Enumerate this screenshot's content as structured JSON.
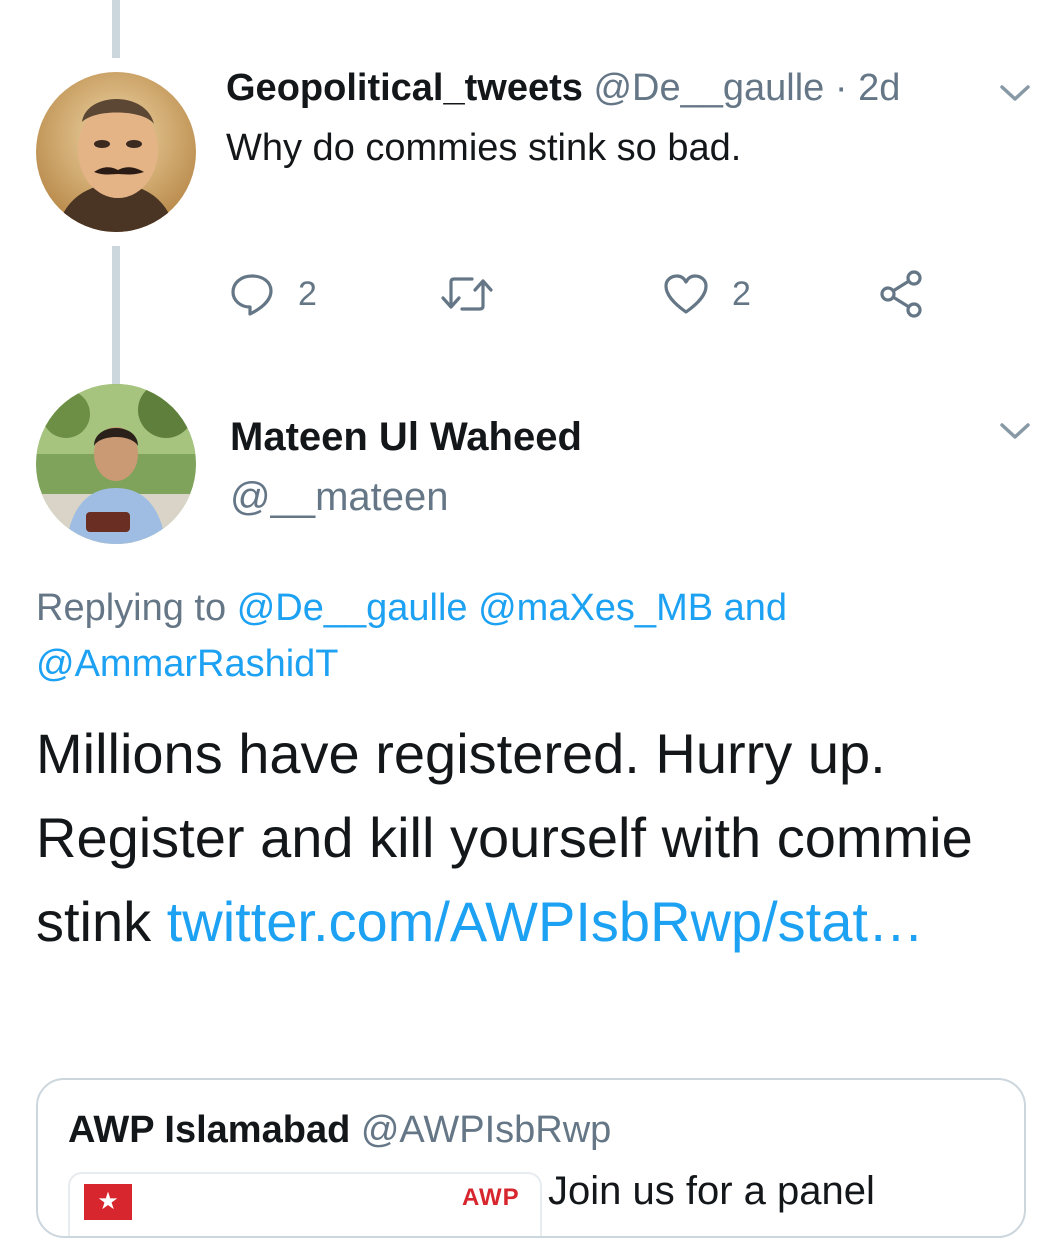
{
  "tweet1": {
    "display_name": "Geopolitical_tweets",
    "handle": "@De__gaulle",
    "separator": " · ",
    "time": "2d",
    "text": "Why do commies stink so bad.",
    "actions": {
      "reply_count": "2",
      "like_count": "2"
    }
  },
  "tweet2": {
    "display_name": "Mateen Ul Waheed",
    "handle": "@__mateen",
    "replying_prefix": "Replying to",
    "replying_mention1": "@De__gaulle",
    "replying_mention2": "@maXes_MB",
    "replying_and": "and",
    "replying_mention3": "@AmmarRashidT",
    "text": "Millions have registered. Hurry up. Register and kill yourself with commie stink",
    "link_text": "twitter.com/AWPIsbRwp/stat…"
  },
  "quoted_tweet": {
    "display_name": "AWP Islamabad",
    "handle": "@AWPIsbRwp",
    "media_flag": "★",
    "media_logo_text": "AWP",
    "text": "Join us for a panel"
  },
  "colors": {
    "link": "#1da1f2",
    "secondary_text": "#657786",
    "primary_text": "#14171a",
    "thread_line": "#ccd6dd"
  },
  "icons": {
    "caret": "chevron-down-icon",
    "reply": "reply-icon",
    "retweet": "retweet-icon",
    "like": "heart-icon",
    "share": "share-icon"
  }
}
